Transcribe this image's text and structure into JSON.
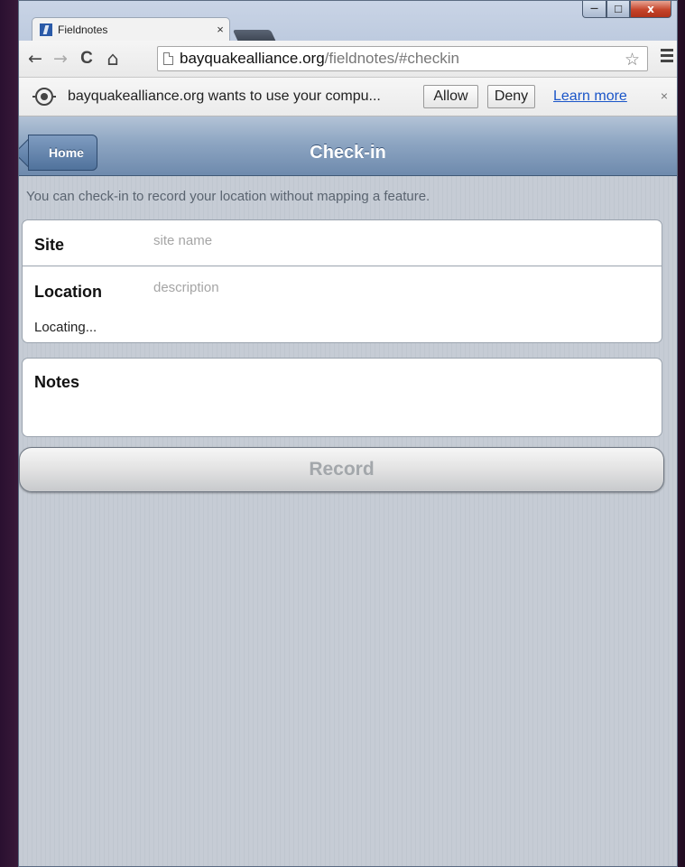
{
  "browser": {
    "tab": {
      "title": "Fieldnotes",
      "close_glyph": "×"
    },
    "nav": {
      "back": "←",
      "forward": "→",
      "reload": "C",
      "home": "⌂"
    },
    "url": {
      "domain": "bayquakealliance.org",
      "path": "/fieldnotes/#checkin"
    },
    "star": "☆",
    "window_controls": {
      "minimize": "—",
      "maximize": "☐",
      "close": "x"
    }
  },
  "infobar": {
    "message": "bayquakealliance.org wants to use your compu...",
    "allow_label": "Allow",
    "deny_label": "Deny",
    "learn_more_label": "Learn more",
    "close_glyph": "×"
  },
  "app": {
    "header": {
      "home_label": "Home",
      "title": "Check-in"
    },
    "intro": "You can check-in to record your location without mapping a feature.",
    "site": {
      "label": "Site",
      "placeholder": "site name"
    },
    "location": {
      "label": "Location",
      "placeholder": "description",
      "status": "Locating..."
    },
    "notes": {
      "label": "Notes"
    },
    "record_label": "Record"
  }
}
